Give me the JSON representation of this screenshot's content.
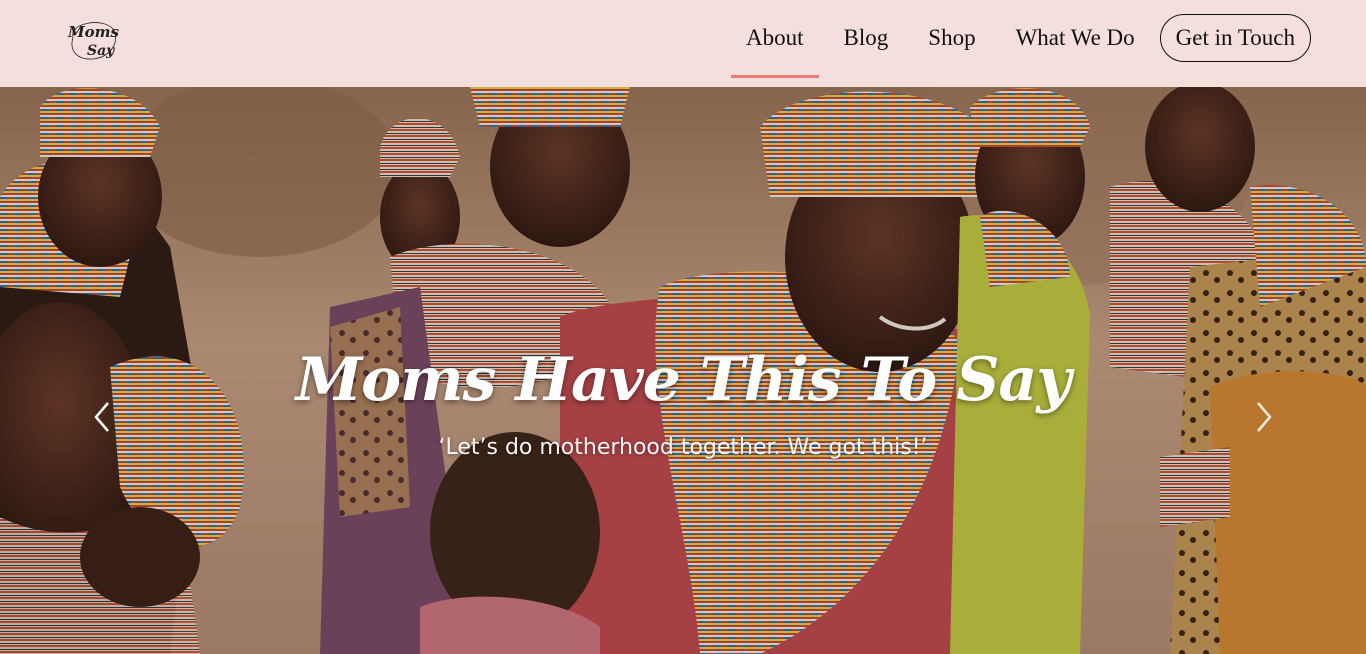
{
  "brand": {
    "logo_line1": "Moms",
    "logo_line2": "Say"
  },
  "nav": {
    "items": [
      {
        "label": "About",
        "active": true
      },
      {
        "label": "Blog",
        "active": false
      },
      {
        "label": "Shop",
        "active": false
      },
      {
        "label": "What We Do",
        "active": false
      }
    ],
    "cta_label": "Get in Touch"
  },
  "hero": {
    "title": "Moms Have This To Say",
    "subtitle": "‘Let’s do motherhood together. We got this!’",
    "prev_icon": "chevron-left-icon",
    "next_icon": "chevron-right-icon"
  },
  "colors": {
    "nav_background": "#f4dfdd",
    "active_underline": "#ec7a7c",
    "text_dark": "#111111",
    "hero_text": "#ffffff"
  }
}
